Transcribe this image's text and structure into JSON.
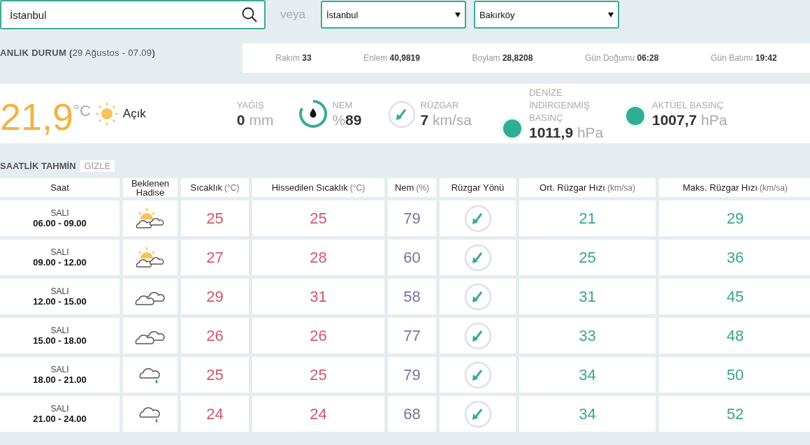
{
  "search": {
    "value": "İstanbul"
  },
  "or_label": "veya",
  "selects": [
    {
      "value": "İstanbul"
    },
    {
      "value": "Bakırköy"
    }
  ],
  "current_title": "**ANLIK DURUM (**29 Ağustos - 07.09**)**",
  "location_info": [
    {
      "label": "Rakım",
      "value": "33"
    },
    {
      "label": "Enlem",
      "value": "40,9819"
    },
    {
      "label": "Boylam",
      "value": "28,8208"
    },
    {
      "label": "Gün Doğumu",
      "value": "06:28"
    },
    {
      "label": "Gün Batımı",
      "value": "19:42"
    }
  ],
  "current": {
    "temperature": "21,9",
    "unit": "°C",
    "condition": "Açık",
    "stats": [
      {
        "kind": "plain",
        "label": "YAĞIŞ",
        "value": "0",
        "unit": "mm"
      },
      {
        "kind": "humidity",
        "label": "NEM",
        "prefix": "%",
        "value": "89"
      },
      {
        "kind": "wind",
        "label": "RÜZGAR",
        "value": "7",
        "unit": "km/sa"
      },
      {
        "kind": "pressure",
        "label": "DENİZE İNDİRGENMİŞ BASINÇ",
        "value": "1011,9",
        "unit": "hPa"
      },
      {
        "kind": "pressure",
        "label": "AKTÜEL BASINÇ",
        "value": "1007,7",
        "unit": "hPa"
      }
    ]
  },
  "forecast": {
    "title": "SAATLİK TAHMİN",
    "toggle": "GİZLE",
    "columns": [
      {
        "name": "Saat"
      },
      {
        "name": "Beklenen Hadise"
      },
      {
        "name": "Sıcaklık",
        "unit": "(°C)"
      },
      {
        "name": "Hissedilen Sıcaklık",
        "unit": "(°C)"
      },
      {
        "name": "Nem",
        "unit": "(%)"
      },
      {
        "name": "Rüzgar Yönü"
      },
      {
        "name": "Ort. Rüzgar Hızı",
        "unit": "(km/sa)"
      },
      {
        "name": "Maks. Rüzgar Hızı",
        "unit": "(km/sa)"
      }
    ],
    "rows": [
      {
        "day": "SALI",
        "time": "06.00 - 09.00",
        "kind": "partly-cloudy",
        "temp": "25",
        "feels": "25",
        "humidity": "79",
        "avg_wind": "21",
        "max_wind": "29"
      },
      {
        "day": "SALI",
        "time": "09.00 - 12.00",
        "kind": "partly-cloudy",
        "temp": "27",
        "feels": "28",
        "humidity": "60",
        "avg_wind": "25",
        "max_wind": "36"
      },
      {
        "day": "SALI",
        "time": "12.00 - 15.00",
        "kind": "cloudy",
        "temp": "29",
        "feels": "31",
        "humidity": "58",
        "avg_wind": "31",
        "max_wind": "45"
      },
      {
        "day": "SALI",
        "time": "15.00 - 18.00",
        "kind": "cloudy",
        "temp": "26",
        "feels": "26",
        "humidity": "77",
        "avg_wind": "33",
        "max_wind": "48"
      },
      {
        "day": "SALI",
        "time": "18.00 - 21.00",
        "kind": "rain",
        "temp": "25",
        "feels": "25",
        "humidity": "79",
        "avg_wind": "34",
        "max_wind": "50"
      },
      {
        "day": "SALI",
        "time": "21.00 - 24.00",
        "kind": "rain",
        "temp": "24",
        "feels": "24",
        "humidity": "68",
        "avg_wind": "34",
        "max_wind": "52"
      }
    ]
  }
}
